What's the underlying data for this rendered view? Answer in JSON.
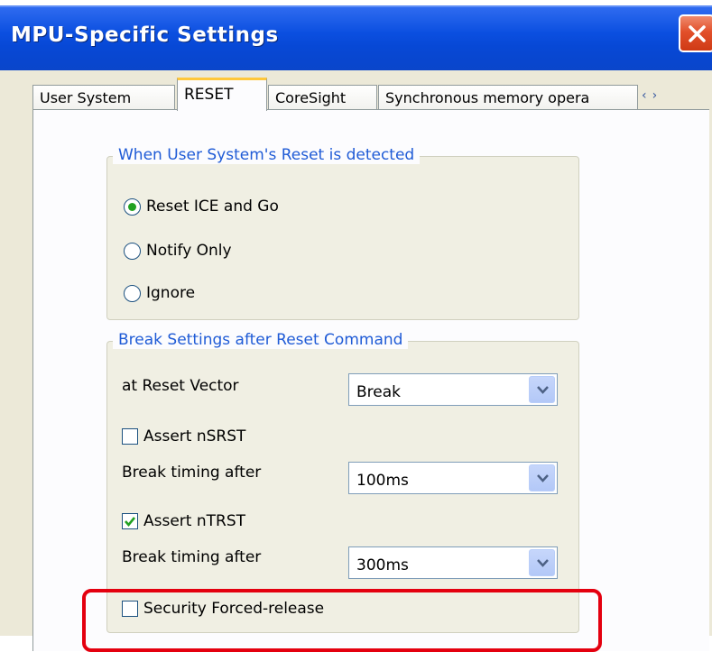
{
  "window": {
    "title": "MPU-Specific Settings",
    "close_icon": "close-icon"
  },
  "tabs": [
    {
      "label": "User System",
      "active": false
    },
    {
      "label": "RESET",
      "active": true
    },
    {
      "label": "CoreSight",
      "active": false
    },
    {
      "label": "Synchronous memory opera",
      "active": false
    }
  ],
  "tab_scroll": {
    "left": "‹",
    "right": "›"
  },
  "reset_detected": {
    "legend": "When User System's Reset is detected",
    "options": [
      {
        "label": "Reset ICE and Go",
        "selected": true
      },
      {
        "label": "Notify Only",
        "selected": false
      },
      {
        "label": "Ignore",
        "selected": false
      }
    ]
  },
  "break_settings": {
    "legend": "Break Settings after Reset Command",
    "reset_vector_label": "at Reset Vector",
    "reset_vector_value": "Break",
    "assert_nsrst_label": "Assert nSRST",
    "assert_nsrst_checked": false,
    "nsrst_timing_label": "Break timing after",
    "nsrst_timing_value": "100ms",
    "assert_ntrst_label": "Assert nTRST",
    "assert_ntrst_checked": true,
    "ntrst_timing_label": "Break timing after",
    "ntrst_timing_value": "300ms",
    "security_label": "Security Forced-release",
    "security_checked": false
  },
  "colors": {
    "title_bar": "#0a4fe0",
    "legend_text": "#1f5bd6",
    "highlight": "#e4000f",
    "check_mark": "#21a121"
  }
}
